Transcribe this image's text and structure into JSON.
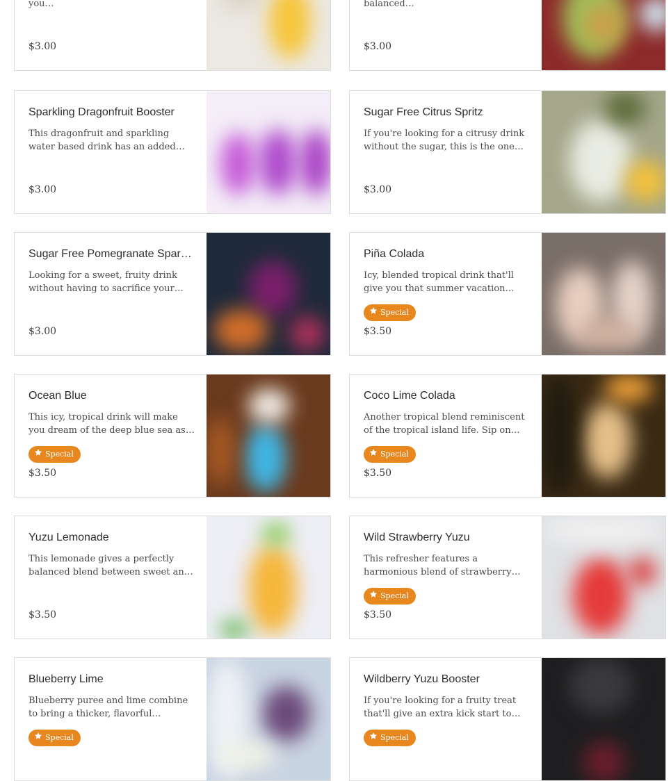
{
  "badge_label": "Special",
  "rows": [
    {
      "left": {
        "name": "",
        "description": "orange, guava and lemon is sure you…",
        "price": "$3.00",
        "special": false,
        "image_alt": "yellow citrus drink"
      },
      "right": {
        "name": "",
        "description": "refresher for you. With a balanced…",
        "price": "$3.00",
        "special": false,
        "image_alt": "green drink with berries"
      }
    },
    {
      "left": {
        "name": "Sparkling Dragonfruit Booster",
        "description": "This dragonfruit and sparkling water based drink has an added boost of…",
        "price": "$3.00",
        "special": false,
        "image_alt": "purple dragonfruit drinks"
      },
      "right": {
        "name": "Sugar Free Citrus Spritz",
        "description": "If you're looking for a citrusy drink without the sugar, this is the one fo…",
        "price": "$3.00",
        "special": false,
        "image_alt": "citrus spritz with lemon"
      }
    },
    {
      "left": {
        "name": "Sugar Free Pomegranate Spar…",
        "description": "Looking for a sweet, fruity drink without having to sacrifice your diet…",
        "price": "$3.00",
        "special": false,
        "image_alt": "pomegranate drink"
      },
      "right": {
        "name": "Piña Colada",
        "description": "Icy, blended tropical drink that'll give you that summer vacation feeling a…",
        "price": "$3.50",
        "special": true,
        "image_alt": "pina colada drinks"
      }
    },
    {
      "left": {
        "name": "Ocean Blue",
        "description": "This icy, tropical drink will make you dream of the deep blue sea as you…",
        "price": "$3.50",
        "special": true,
        "image_alt": "blue tropical drink"
      },
      "right": {
        "name": "Coco Lime Colada",
        "description": "Another tropical blend reminiscent of the tropical island life. Sip on this…",
        "price": "$3.50",
        "special": true,
        "image_alt": "coco lime colada"
      }
    },
    {
      "left": {
        "name": "Yuzu Lemonade",
        "description": "This lemonade gives a perfectly balanced blend between sweet an…",
        "price": "$3.50",
        "special": false,
        "image_alt": "yuzu lemonade"
      },
      "right": {
        "name": "Wild Strawberry Yuzu",
        "description": "This refresher features a harmonious blend of strawberry and yuzu lemo…",
        "price": "$3.50",
        "special": true,
        "image_alt": "strawberry yuzu drink"
      }
    },
    {
      "left": {
        "name": "Blueberry Lime",
        "description": "Blueberry puree and lime combine to bring a thicker, flavorful refresher…",
        "price": "",
        "special": true,
        "image_alt": "blueberry lime drink"
      },
      "right": {
        "name": "Wildberry Yuzu Booster",
        "description": "If you're looking for a fruity treat that'll give an extra kick start to you…",
        "price": "",
        "special": true,
        "image_alt": "wildberry yuzu drink"
      }
    }
  ]
}
